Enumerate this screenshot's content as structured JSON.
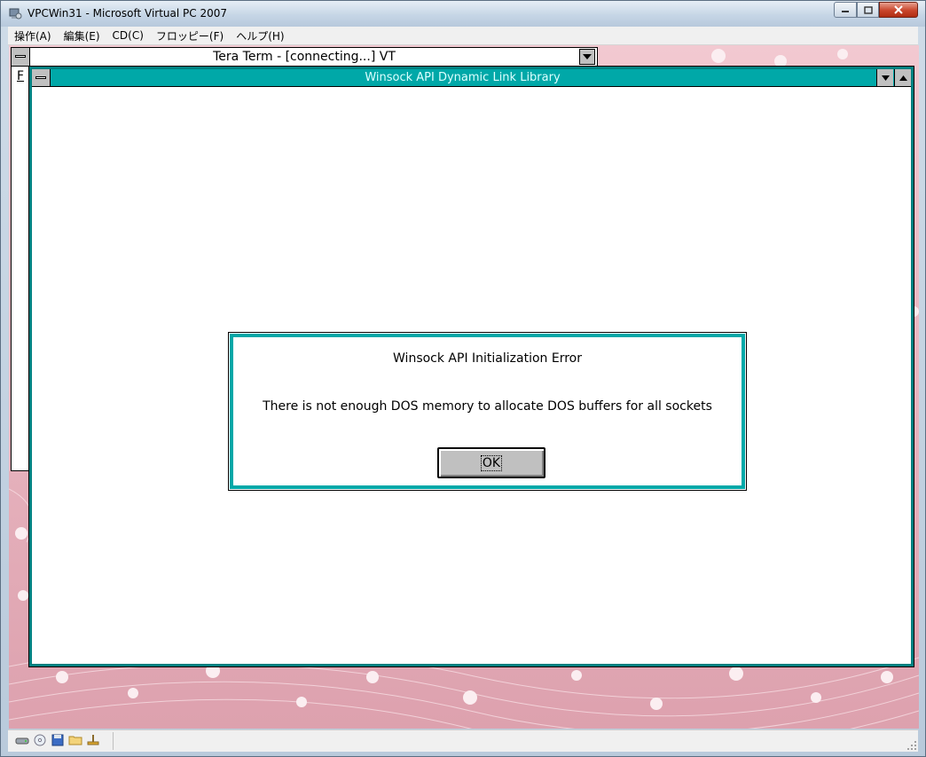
{
  "host": {
    "title": "VPCWin31 - Microsoft Virtual PC 2007",
    "menu": [
      "操作(A)",
      "編集(E)",
      "CD(C)",
      "フロッピー(F)",
      "ヘルプ(H)"
    ],
    "caption_buttons": [
      "minimize-icon",
      "maximize-icon",
      "close-icon"
    ]
  },
  "teraterm": {
    "title": "Tera Term - [connecting...] VT",
    "menu_letter": "F"
  },
  "winsock": {
    "title": "Winsock API Dynamic Link Library"
  },
  "dialog": {
    "title": "Winsock API Initialization Error",
    "message": "There is not enough DOS memory to allocate DOS buffers for all sockets",
    "ok_label": "OK"
  },
  "statusbar": {
    "icons": [
      "hard-disk-icon",
      "cd-icon",
      "floppy-icon",
      "shared-folder-icon",
      "network-icon"
    ]
  },
  "colors": {
    "win31_teal": "#00a8a8",
    "dialog_border": "#00a8a8",
    "wallpaper_pink": "#e7b6c1"
  }
}
